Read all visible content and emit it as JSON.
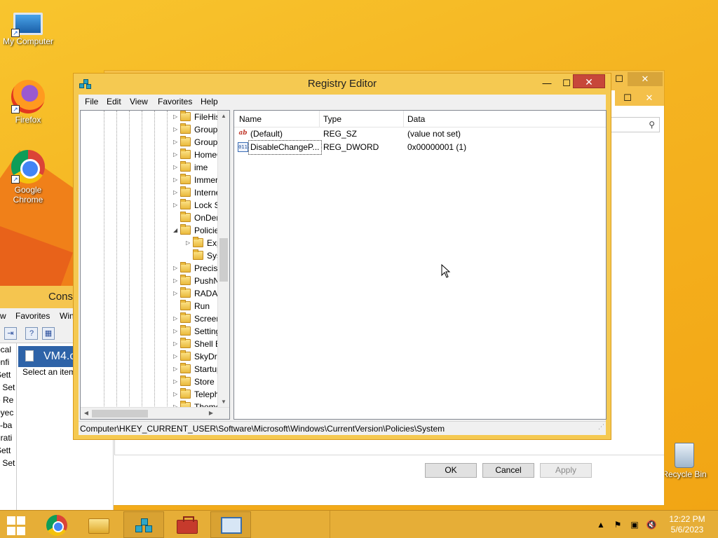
{
  "desktop": {
    "icons": [
      {
        "label": "My Computer"
      },
      {
        "label": "Firefox"
      },
      {
        "label": "Google Chrome"
      },
      {
        "label": "Recycle Bin"
      }
    ]
  },
  "bg_dialog": {
    "ok_label": "OK",
    "cancel_label": "Cancel",
    "apply_label": "Apply"
  },
  "console": {
    "title": "Conso",
    "menu": [
      "w",
      "Favorites",
      "Win"
    ],
    "tree_items": [
      "ocal",
      "onfi",
      "Sett",
      "s Set",
      "e Re",
      "oyec",
      "y-ba",
      "urati",
      "Sett",
      "s Set"
    ],
    "pane_title": "VM4.c",
    "pane_text": "Select an item"
  },
  "regedit": {
    "title": "Registry Editor",
    "menu": [
      "File",
      "Edit",
      "View",
      "Favorites",
      "Help"
    ],
    "tree": [
      {
        "label": "FileHist",
        "expander": "collapsed",
        "level": 0
      },
      {
        "label": "Group I",
        "expander": "collapsed",
        "level": 0
      },
      {
        "label": "Group I",
        "expander": "collapsed",
        "level": 0
      },
      {
        "label": "HomeG",
        "expander": "collapsed",
        "level": 0
      },
      {
        "label": "ime",
        "expander": "collapsed",
        "level": 0
      },
      {
        "label": "Immers",
        "expander": "collapsed",
        "level": 0
      },
      {
        "label": "Interne",
        "expander": "collapsed",
        "level": 0
      },
      {
        "label": "Lock Sc",
        "expander": "collapsed",
        "level": 0
      },
      {
        "label": "OnDem",
        "expander": "none",
        "level": 0
      },
      {
        "label": "Policies",
        "expander": "expanded",
        "level": 0
      },
      {
        "label": "Exp",
        "expander": "collapsed",
        "level": 1
      },
      {
        "label": "Syst",
        "expander": "none",
        "level": 1
      },
      {
        "label": "Precisio",
        "expander": "collapsed",
        "level": 0
      },
      {
        "label": "PushNo",
        "expander": "collapsed",
        "level": 0
      },
      {
        "label": "RADAR",
        "expander": "collapsed",
        "level": 0
      },
      {
        "label": "Run",
        "expander": "none",
        "level": 0
      },
      {
        "label": "Screens",
        "expander": "collapsed",
        "level": 0
      },
      {
        "label": "Setting",
        "expander": "collapsed",
        "level": 0
      },
      {
        "label": "Shell Ex",
        "expander": "collapsed",
        "level": 0
      },
      {
        "label": "SkyDriv",
        "expander": "collapsed",
        "level": 0
      },
      {
        "label": "Startup",
        "expander": "collapsed",
        "level": 0
      },
      {
        "label": "Store",
        "expander": "collapsed",
        "level": 0
      },
      {
        "label": "Teleph",
        "expander": "collapsed",
        "level": 0
      },
      {
        "label": "Theme",
        "expander": "collapsed",
        "level": 0
      }
    ],
    "columns": {
      "name": "Name",
      "type": "Type",
      "data": "Data"
    },
    "values": [
      {
        "name": "(Default)",
        "type": "REG_SZ",
        "data": "(value not set)",
        "icon": "string-value-icon",
        "glyph": "ab"
      },
      {
        "name": "DisableChangeP...",
        "type": "REG_DWORD",
        "data": "0x00000001 (1)",
        "icon": "dword-value-icon",
        "glyph": "011"
      }
    ],
    "status_path": "Computer\\HKEY_CURRENT_USER\\Software\\Microsoft\\Windows\\CurrentVersion\\Policies\\System"
  },
  "taskbar": {
    "apps": [
      "start-button",
      "chrome",
      "file-explorer",
      "registry-editor",
      "toolbox",
      "mmc-console"
    ],
    "clock_time": "12:22 PM",
    "clock_date": "5/6/2023"
  },
  "colors": {
    "desktop_bg": "#f5b421",
    "window_frame": "#f5c951",
    "close_button": "#c7473a",
    "taskbar": "#e6ae37"
  }
}
